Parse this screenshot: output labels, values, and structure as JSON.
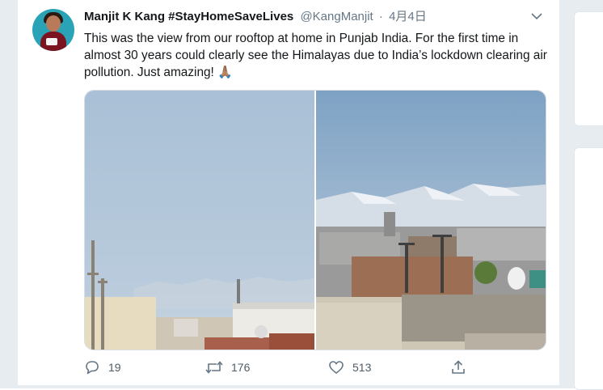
{
  "tweet": {
    "author_name": "Manjit K Kang #StayHomeSaveLives",
    "handle": "@KangManjit",
    "separator": "·",
    "date": "4月4日",
    "text": "This was the view from our rooftop at home in Punjab India. For the first time in almost 30 years could clearly see the Himalayas due to India’s lockdown clearing air pollution. Just amazing!",
    "emoji": "🙏🏽"
  },
  "actions": {
    "replies": "19",
    "retweets": "176",
    "likes": "513"
  },
  "icons": {
    "reply": "reply-icon",
    "retweet": "retweet-icon",
    "like": "heart-icon",
    "share": "share-icon",
    "menu": "chevron-down-icon"
  },
  "colors": {
    "text": "#14171a",
    "secondary": "#657786",
    "background": "#e6ecf0"
  }
}
